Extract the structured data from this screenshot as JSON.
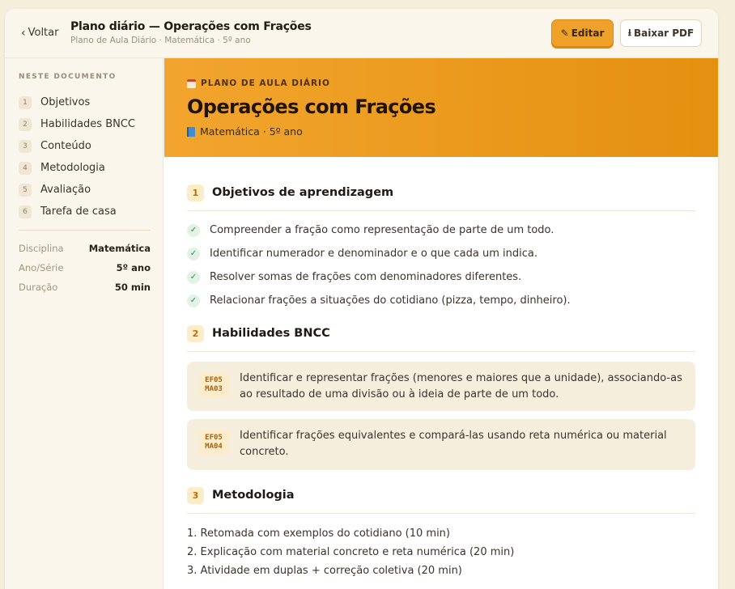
{
  "topbar": {
    "back_label": "Voltar",
    "title": "Plano diário — Operações com Frações",
    "breadcrumb": "Plano de Aula Diário · Matemática · 5º ano",
    "edit_label": "Editar",
    "pdf_label": "Baixar PDF"
  },
  "sidebar": {
    "heading": "NESTE DOCUMENTO",
    "items": [
      {
        "num": "1",
        "label": "Objetivos"
      },
      {
        "num": "2",
        "label": "Habilidades BNCC"
      },
      {
        "num": "3",
        "label": "Conteúdo"
      },
      {
        "num": "4",
        "label": "Metodologia"
      },
      {
        "num": "5",
        "label": "Avaliação"
      },
      {
        "num": "6",
        "label": "Tarefa de casa"
      }
    ],
    "meta": [
      {
        "key": "Disciplina",
        "value": "Matemática"
      },
      {
        "key": "Ano/Série",
        "value": "5º ano"
      },
      {
        "key": "Duração",
        "value": "50 min"
      }
    ]
  },
  "hero": {
    "eyebrow": "PLANO DE AULA DIÁRIO",
    "title": "Operações com Frações",
    "subtitle": "Matemática · 5º ano"
  },
  "sections": {
    "objectives": {
      "num": "1",
      "title": "Objetivos de aprendizagem",
      "items": [
        "Compreender a fração como representação de parte de um todo.",
        "Identificar numerador e denominador e o que cada um indica.",
        "Resolver somas de frações com denominadores diferentes.",
        "Relacionar frações a situações do cotidiano (pizza, tempo, dinheiro)."
      ]
    },
    "bncc": {
      "num": "2",
      "title": "Habilidades BNCC",
      "skills": [
        {
          "code_top": "EF05",
          "code_bottom": "MA03",
          "text": "Identificar e representar frações (menores e maiores que a unidade), associando-as ao resultado de uma divisão ou à ideia de parte de um todo."
        },
        {
          "code_top": "EF05",
          "code_bottom": "MA04",
          "text": "Identificar frações equivalentes e compará-las usando reta numérica ou material concreto."
        }
      ]
    },
    "methodology": {
      "num": "3",
      "title": "Metodologia",
      "steps": [
        "1. Retomada com exemplos do cotidiano (10 min)",
        "2. Explicação com material concreto e reta numérica (20 min)",
        "3. Atividade em duplas + correção coletiva (20 min)"
      ]
    }
  }
}
